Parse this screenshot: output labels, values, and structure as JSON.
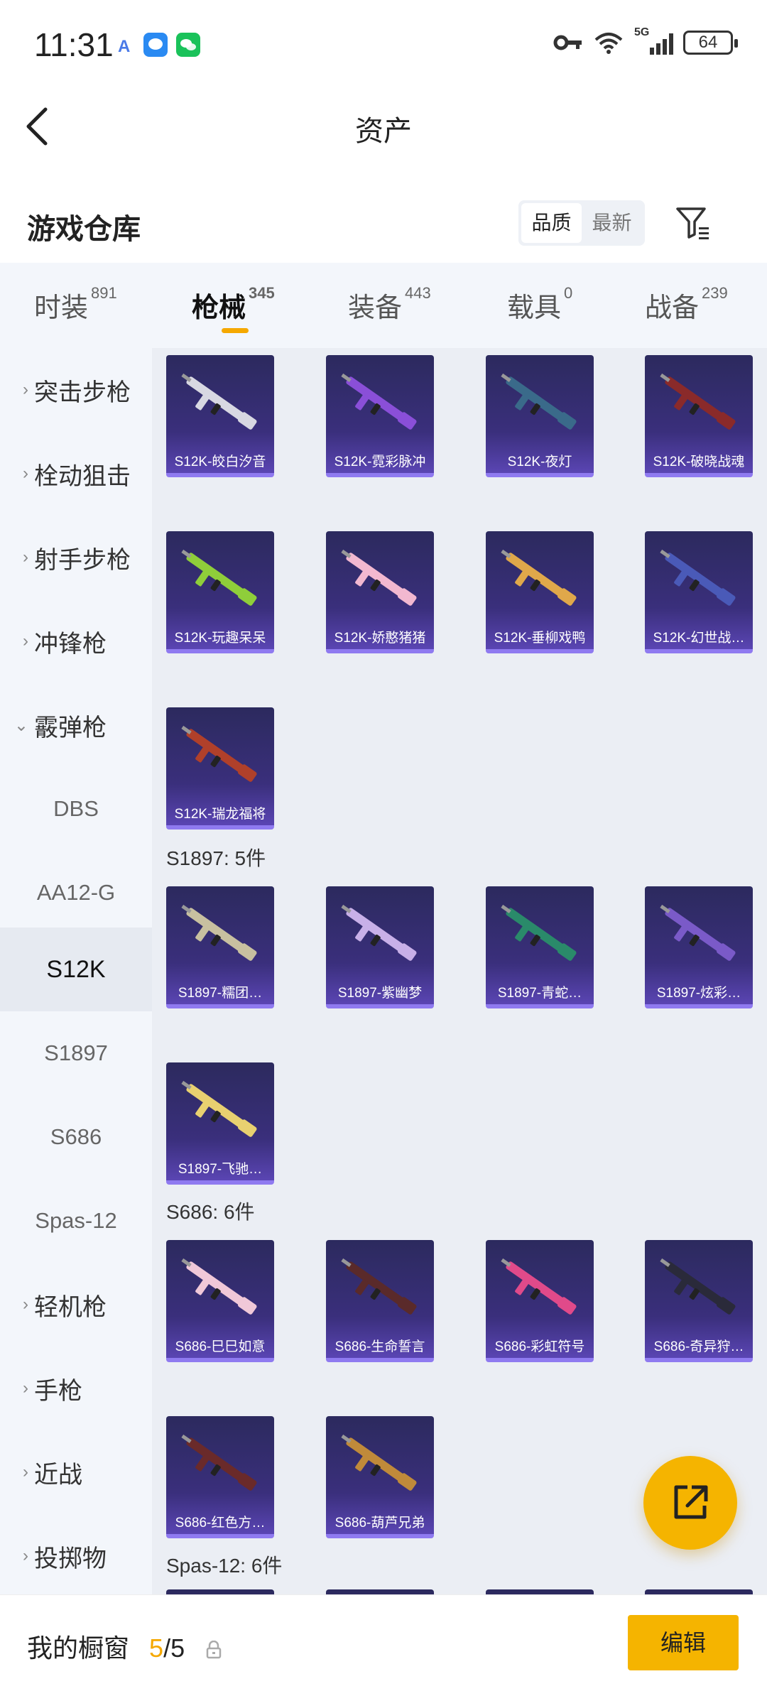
{
  "status_bar": {
    "time": "11:31",
    "battery": "64",
    "network": "5G"
  },
  "header": {
    "title": "资产"
  },
  "warehouse": {
    "title": "游戏仓库",
    "sort_options": [
      {
        "label": "品质"
      },
      {
        "label": "最新"
      }
    ]
  },
  "tabs": [
    {
      "label": "时装",
      "count": "891"
    },
    {
      "label": "枪械",
      "count": "345"
    },
    {
      "label": "装备",
      "count": "443"
    },
    {
      "label": "载具",
      "count": "0"
    },
    {
      "label": "战备",
      "count": "239"
    }
  ],
  "sidebar": {
    "items": [
      {
        "label": "突击步枪",
        "chevron": "›"
      },
      {
        "label": "栓动狙击",
        "chevron": "›"
      },
      {
        "label": "射手步枪",
        "chevron": "›"
      },
      {
        "label": "冲锋枪",
        "chevron": "›"
      },
      {
        "label": "霰弹枪",
        "chevron": "⌄"
      },
      {
        "label": "DBS"
      },
      {
        "label": "AA12-G"
      },
      {
        "label": "S12K"
      },
      {
        "label": "S1897"
      },
      {
        "label": "S686"
      },
      {
        "label": "Spas-12"
      },
      {
        "label": "轻机枪",
        "chevron": "›"
      },
      {
        "label": "手枪",
        "chevron": "›"
      },
      {
        "label": "近战",
        "chevron": "›"
      },
      {
        "label": "投掷物",
        "chevron": "›"
      }
    ]
  },
  "groups": {
    "s12k": {
      "items": [
        {
          "name": "S12K-皎白汐音",
          "color": "#d8d8e2"
        },
        {
          "name": "S12K-霓彩脉冲",
          "color": "#8a4fd8"
        },
        {
          "name": "S12K-夜灯",
          "color": "#3a6a8a"
        },
        {
          "name": "S12K-破晓战魂",
          "color": "#8a2a2a"
        },
        {
          "name": "S12K-玩趣呆呆",
          "color": "#8fce3a"
        },
        {
          "name": "S12K-娇憨猪猪",
          "color": "#f2b8d0"
        },
        {
          "name": "S12K-垂柳戏鸭",
          "color": "#e0a84a"
        },
        {
          "name": "S12K-幻世战…",
          "color": "#4a5ab8"
        },
        {
          "name": "S12K-瑞龙福将",
          "color": "#b0402a"
        }
      ]
    },
    "s1897": {
      "label": "S1897: 5件",
      "items": [
        {
          "name": "S1897-糯团…",
          "color": "#c8c0a0"
        },
        {
          "name": "S1897-紫幽梦",
          "color": "#c8b0e8"
        },
        {
          "name": "S1897-青蛇…",
          "color": "#2a8a6a"
        },
        {
          "name": "S1897-炫彩…",
          "color": "#7a5ac8"
        },
        {
          "name": "S1897-飞驰…",
          "color": "#e8d070"
        }
      ]
    },
    "s686": {
      "label": "S686: 6件",
      "items": [
        {
          "name": "S686-巳巳如意",
          "color": "#f0c8d8"
        },
        {
          "name": "S686-生命誓言",
          "color": "#5a2a2a"
        },
        {
          "name": "S686-彩虹符号",
          "color": "#e04a8a"
        },
        {
          "name": "S686-奇异狩…",
          "color": "#2a2a3a"
        },
        {
          "name": "S686-红色方…",
          "color": "#6a2a2a"
        },
        {
          "name": "S686-葫芦兄弟",
          "color": "#c08a3a"
        }
      ]
    },
    "spas12": {
      "label": "Spas-12: 6件"
    }
  },
  "bottom_bar": {
    "showcase_label": "我的橱窗",
    "showcase_current": "5",
    "showcase_separator": "/",
    "showcase_total": "5",
    "edit_label": "编辑"
  },
  "colors": {
    "accent": "#f5b400",
    "card_bg": "#3a2f7c",
    "card_border": "#8f7af0"
  }
}
